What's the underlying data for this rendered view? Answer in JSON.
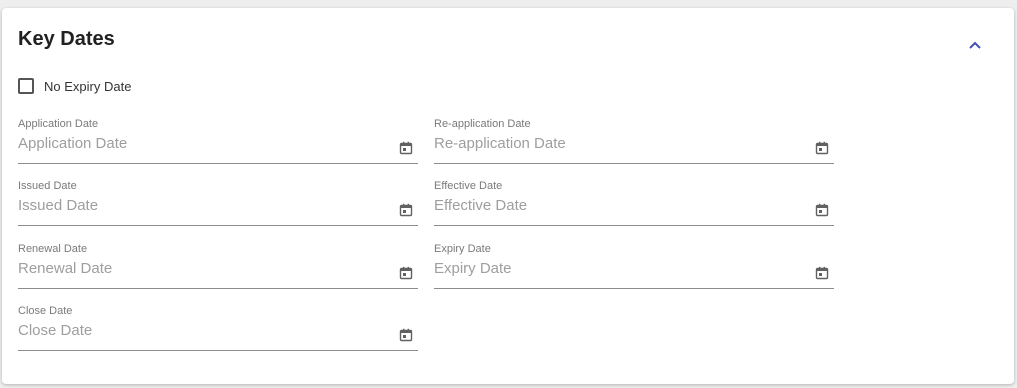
{
  "section": {
    "title": "Key Dates",
    "collapse_icon": "chevron-up-icon",
    "accent_color": "#3f51b5"
  },
  "no_expiry": {
    "label": "No Expiry Date",
    "checked": false
  },
  "fields": {
    "application_date": {
      "label": "Application Date",
      "placeholder": "Application Date",
      "value": ""
    },
    "reapplication_date": {
      "label": "Re-application Date",
      "placeholder": "Re-application Date",
      "value": ""
    },
    "issued_date": {
      "label": "Issued Date",
      "placeholder": "Issued Date",
      "value": ""
    },
    "effective_date": {
      "label": "Effective Date",
      "placeholder": "Effective Date",
      "value": ""
    },
    "renewal_date": {
      "label": "Renewal Date",
      "placeholder": "Renewal Date",
      "value": ""
    },
    "expiry_date": {
      "label": "Expiry Date",
      "placeholder": "Expiry Date",
      "value": ""
    },
    "close_date": {
      "label": "Close Date",
      "placeholder": "Close Date",
      "value": ""
    }
  },
  "calendar_icon": "calendar-icon"
}
